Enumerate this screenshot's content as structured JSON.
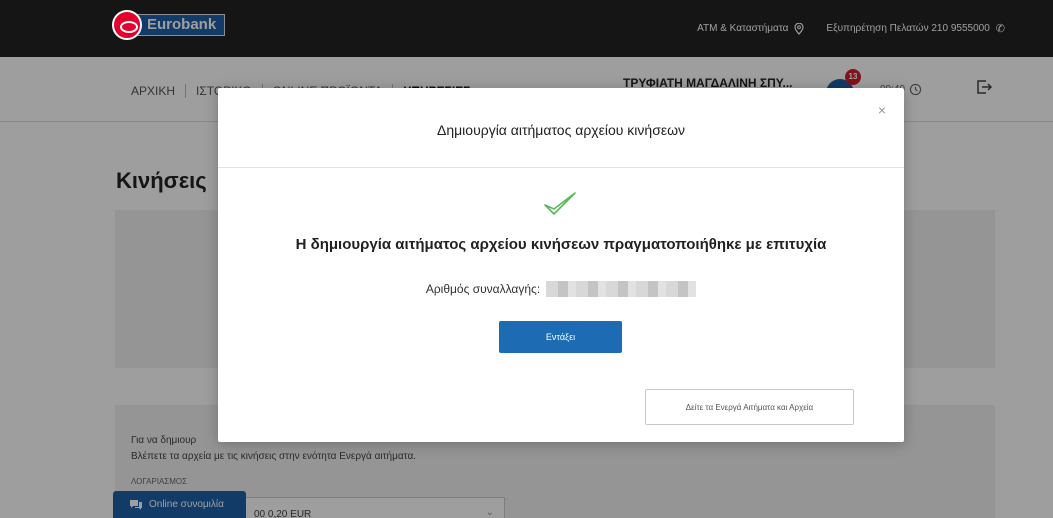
{
  "header": {
    "brand": "Eurobank",
    "atm_link": "ATM & Καταστήματα",
    "support_link": "Εξυπηρέτηση Πελατών 210 9555000"
  },
  "nav": {
    "items": [
      "ΑΡΧΙΚΗ",
      "ΙΣΤΟΡΙΚΟ",
      "ONLINE ΠΡΟΪΟΝΤΑ",
      "ΥΠΗΡΕΣΙΕΣ"
    ],
    "user_name": "ΤΡΥΦΙΑΤΗ ΜΑΓΔΑΛΙΝΗ ΣΠΥ...",
    "notifications": "13",
    "session_time": "09:49"
  },
  "page": {
    "title": "Κινήσεις",
    "info_line1": "Για να δημιουρ",
    "info_line2": "Βλέπετε τα αρχεία με τις κινήσεις στην ενότητα Ενεργά αιτήματα.",
    "account_label": "ΛΟΓΑΡΙΑΣΜΟΣ",
    "account_value": "00 0,20 EUR"
  },
  "chat": {
    "label": "Online συνομιλία"
  },
  "modal": {
    "title": "Δημιουργία αιτήματος αρχείου κινήσεων",
    "close": "×",
    "success_message": "Η δημιουργία αιτήματος αρχείου κινήσεων πραγματοποιήθηκε με επιτυχία",
    "transaction_label": "Αριθμός συναλλαγής:",
    "ok_button": "Εντάξει",
    "active_requests_button": "Δείτε τα Ενεργά Αιτήματα και Αρχεία"
  },
  "colors": {
    "brand_blue": "#1d6bb3",
    "success_green": "#5cb85c",
    "top_bar": "#222323"
  }
}
